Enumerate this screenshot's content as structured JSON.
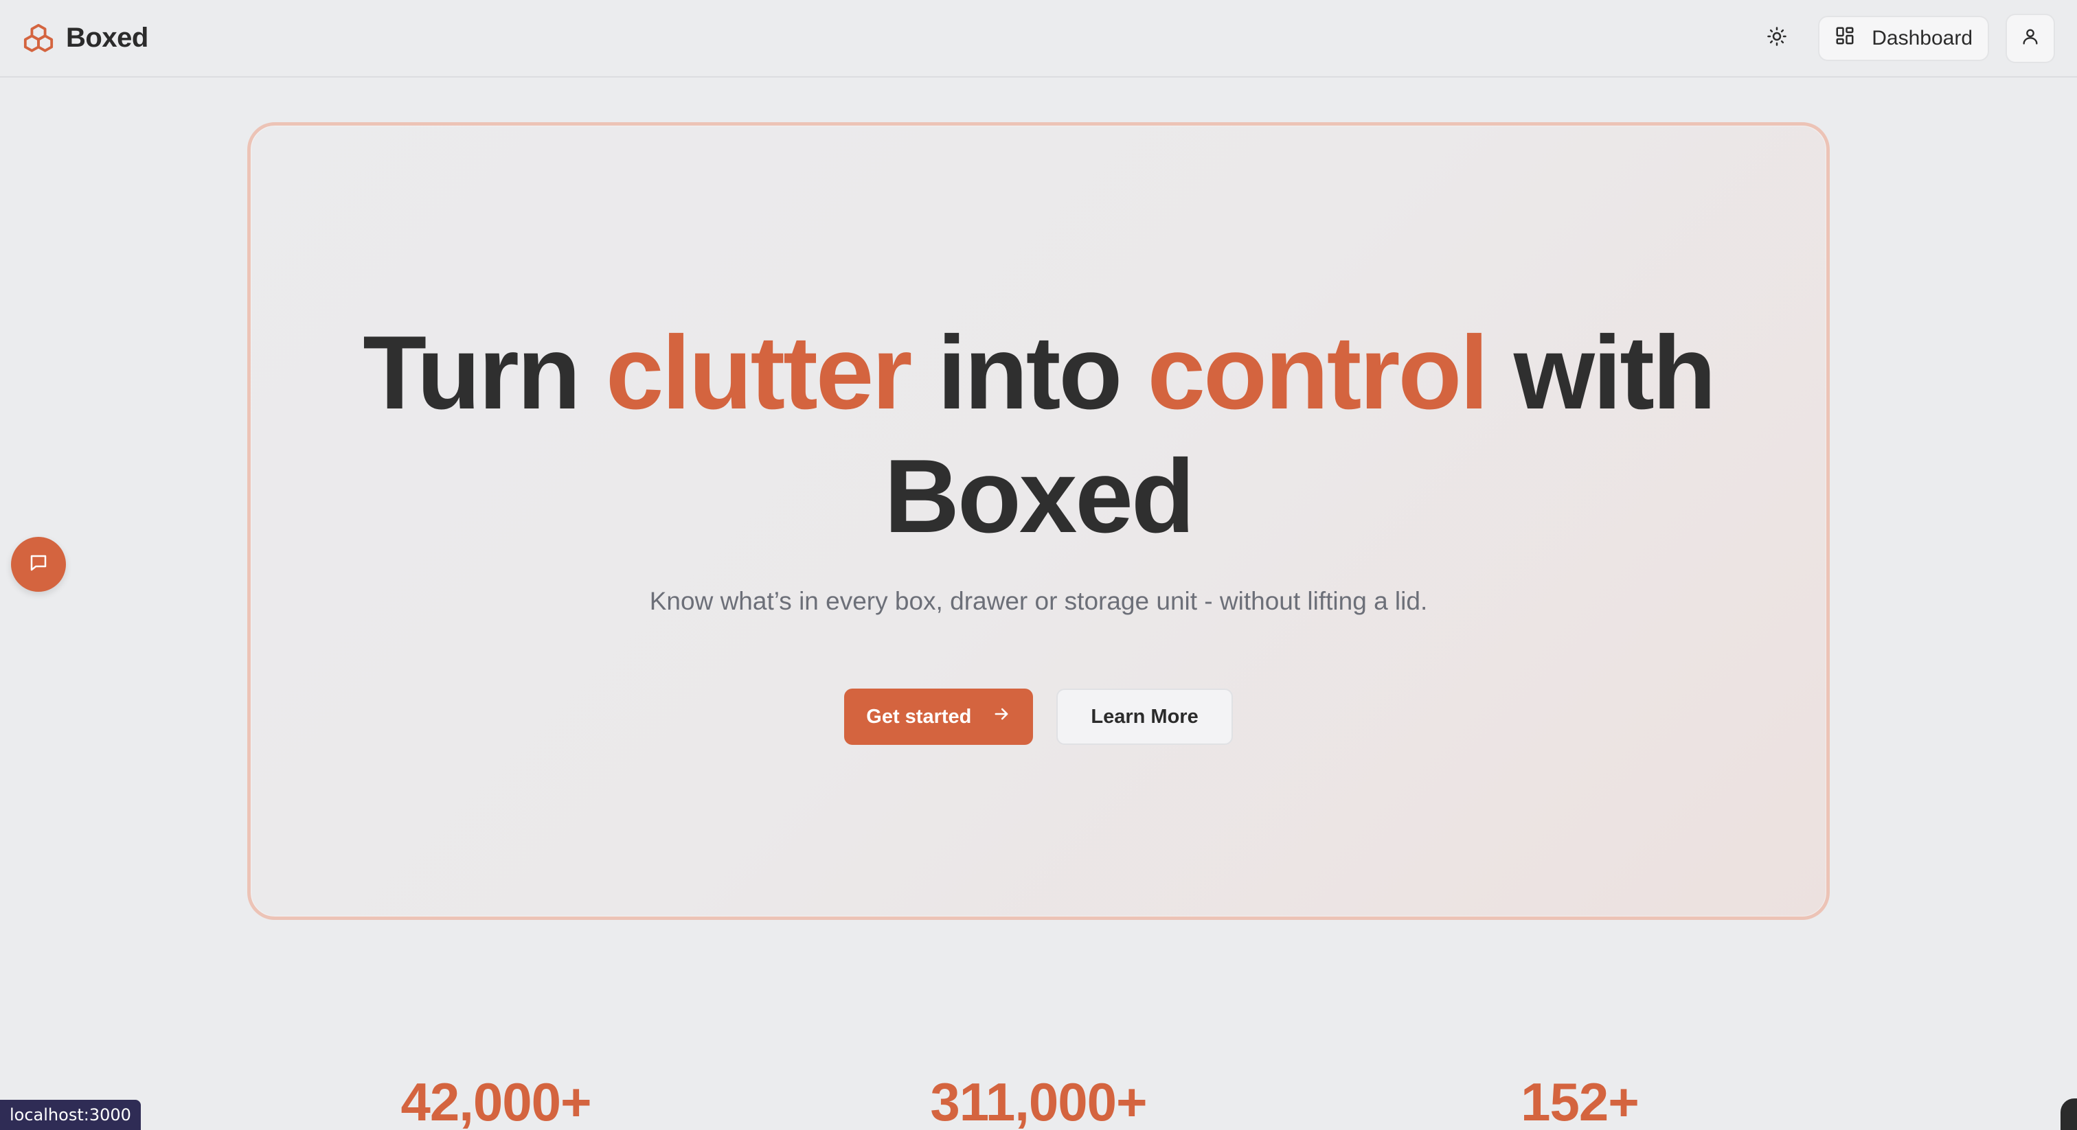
{
  "header": {
    "brand_name": "Boxed",
    "dashboard_label": "Dashboard",
    "icons": {
      "brand": "boxes-logo-icon",
      "theme": "sun-icon",
      "dashboard": "dashboard-grid-icon",
      "user": "user-icon"
    }
  },
  "hero": {
    "title_part1": "Turn ",
    "title_accent1": "clutter",
    "title_part2": " into ",
    "title_accent2": "control",
    "title_part3": " with",
    "title_line2": "Boxed",
    "subtitle": "Know what’s in every box, drawer or storage unit - without lifting a lid.",
    "primary_button": "Get started",
    "secondary_button": "Learn More"
  },
  "stats": [
    {
      "value": "42,000+"
    },
    {
      "value": "311,000+"
    },
    {
      "value": "152+"
    }
  ],
  "status_bar": {
    "url": "localhost:3000"
  },
  "colors": {
    "accent": "#d4643f",
    "background": "#ebecee",
    "text": "#2f2f2f",
    "muted_text": "#6c6f78"
  }
}
